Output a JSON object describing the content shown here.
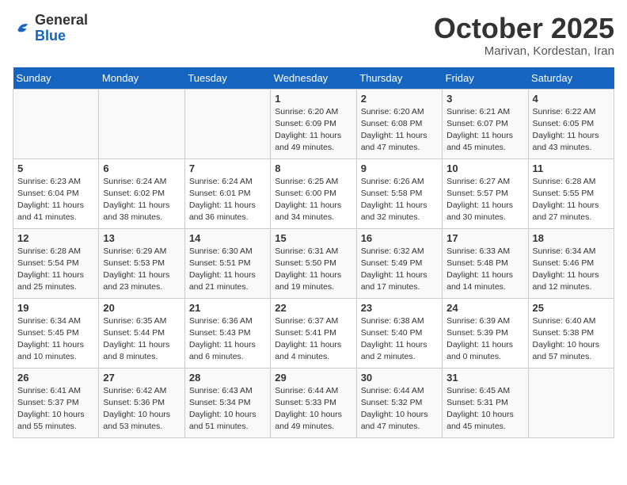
{
  "header": {
    "logo_general": "General",
    "logo_blue": "Blue",
    "title": "October 2025",
    "subtitle": "Marivan, Kordestan, Iran"
  },
  "weekdays": [
    "Sunday",
    "Monday",
    "Tuesday",
    "Wednesday",
    "Thursday",
    "Friday",
    "Saturday"
  ],
  "weeks": [
    [
      {
        "day": "",
        "info": ""
      },
      {
        "day": "",
        "info": ""
      },
      {
        "day": "",
        "info": ""
      },
      {
        "day": "1",
        "info": "Sunrise: 6:20 AM\nSunset: 6:09 PM\nDaylight: 11 hours and 49 minutes."
      },
      {
        "day": "2",
        "info": "Sunrise: 6:20 AM\nSunset: 6:08 PM\nDaylight: 11 hours and 47 minutes."
      },
      {
        "day": "3",
        "info": "Sunrise: 6:21 AM\nSunset: 6:07 PM\nDaylight: 11 hours and 45 minutes."
      },
      {
        "day": "4",
        "info": "Sunrise: 6:22 AM\nSunset: 6:05 PM\nDaylight: 11 hours and 43 minutes."
      }
    ],
    [
      {
        "day": "5",
        "info": "Sunrise: 6:23 AM\nSunset: 6:04 PM\nDaylight: 11 hours and 41 minutes."
      },
      {
        "day": "6",
        "info": "Sunrise: 6:24 AM\nSunset: 6:02 PM\nDaylight: 11 hours and 38 minutes."
      },
      {
        "day": "7",
        "info": "Sunrise: 6:24 AM\nSunset: 6:01 PM\nDaylight: 11 hours and 36 minutes."
      },
      {
        "day": "8",
        "info": "Sunrise: 6:25 AM\nSunset: 6:00 PM\nDaylight: 11 hours and 34 minutes."
      },
      {
        "day": "9",
        "info": "Sunrise: 6:26 AM\nSunset: 5:58 PM\nDaylight: 11 hours and 32 minutes."
      },
      {
        "day": "10",
        "info": "Sunrise: 6:27 AM\nSunset: 5:57 PM\nDaylight: 11 hours and 30 minutes."
      },
      {
        "day": "11",
        "info": "Sunrise: 6:28 AM\nSunset: 5:55 PM\nDaylight: 11 hours and 27 minutes."
      }
    ],
    [
      {
        "day": "12",
        "info": "Sunrise: 6:28 AM\nSunset: 5:54 PM\nDaylight: 11 hours and 25 minutes."
      },
      {
        "day": "13",
        "info": "Sunrise: 6:29 AM\nSunset: 5:53 PM\nDaylight: 11 hours and 23 minutes."
      },
      {
        "day": "14",
        "info": "Sunrise: 6:30 AM\nSunset: 5:51 PM\nDaylight: 11 hours and 21 minutes."
      },
      {
        "day": "15",
        "info": "Sunrise: 6:31 AM\nSunset: 5:50 PM\nDaylight: 11 hours and 19 minutes."
      },
      {
        "day": "16",
        "info": "Sunrise: 6:32 AM\nSunset: 5:49 PM\nDaylight: 11 hours and 17 minutes."
      },
      {
        "day": "17",
        "info": "Sunrise: 6:33 AM\nSunset: 5:48 PM\nDaylight: 11 hours and 14 minutes."
      },
      {
        "day": "18",
        "info": "Sunrise: 6:34 AM\nSunset: 5:46 PM\nDaylight: 11 hours and 12 minutes."
      }
    ],
    [
      {
        "day": "19",
        "info": "Sunrise: 6:34 AM\nSunset: 5:45 PM\nDaylight: 11 hours and 10 minutes."
      },
      {
        "day": "20",
        "info": "Sunrise: 6:35 AM\nSunset: 5:44 PM\nDaylight: 11 hours and 8 minutes."
      },
      {
        "day": "21",
        "info": "Sunrise: 6:36 AM\nSunset: 5:43 PM\nDaylight: 11 hours and 6 minutes."
      },
      {
        "day": "22",
        "info": "Sunrise: 6:37 AM\nSunset: 5:41 PM\nDaylight: 11 hours and 4 minutes."
      },
      {
        "day": "23",
        "info": "Sunrise: 6:38 AM\nSunset: 5:40 PM\nDaylight: 11 hours and 2 minutes."
      },
      {
        "day": "24",
        "info": "Sunrise: 6:39 AM\nSunset: 5:39 PM\nDaylight: 11 hours and 0 minutes."
      },
      {
        "day": "25",
        "info": "Sunrise: 6:40 AM\nSunset: 5:38 PM\nDaylight: 10 hours and 57 minutes."
      }
    ],
    [
      {
        "day": "26",
        "info": "Sunrise: 6:41 AM\nSunset: 5:37 PM\nDaylight: 10 hours and 55 minutes."
      },
      {
        "day": "27",
        "info": "Sunrise: 6:42 AM\nSunset: 5:36 PM\nDaylight: 10 hours and 53 minutes."
      },
      {
        "day": "28",
        "info": "Sunrise: 6:43 AM\nSunset: 5:34 PM\nDaylight: 10 hours and 51 minutes."
      },
      {
        "day": "29",
        "info": "Sunrise: 6:44 AM\nSunset: 5:33 PM\nDaylight: 10 hours and 49 minutes."
      },
      {
        "day": "30",
        "info": "Sunrise: 6:44 AM\nSunset: 5:32 PM\nDaylight: 10 hours and 47 minutes."
      },
      {
        "day": "31",
        "info": "Sunrise: 6:45 AM\nSunset: 5:31 PM\nDaylight: 10 hours and 45 minutes."
      },
      {
        "day": "",
        "info": ""
      }
    ]
  ]
}
